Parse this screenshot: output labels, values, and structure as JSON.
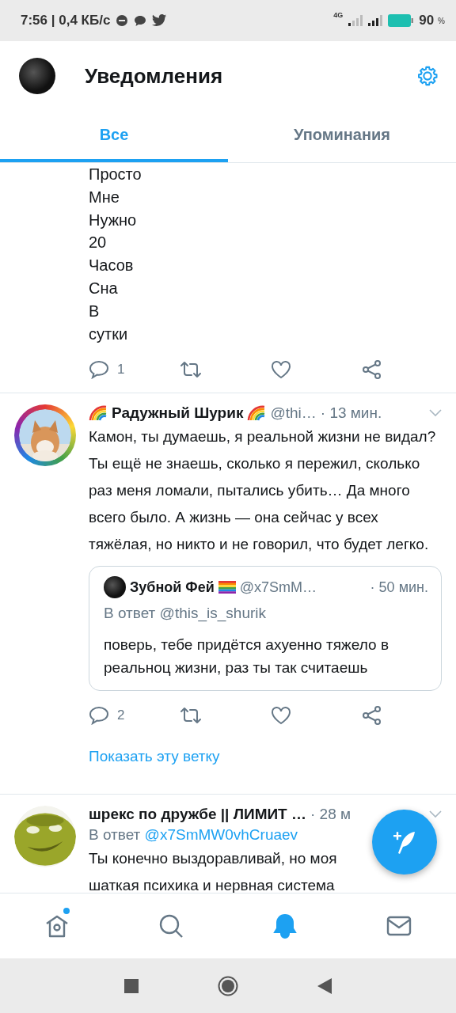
{
  "status_bar": {
    "time_speed": "7:56 | 0,4 КБ/с",
    "network": "4G",
    "battery": "90",
    "percent": "%"
  },
  "header": {
    "title": "Уведомления"
  },
  "tabs": [
    {
      "label": "Все",
      "selected": true
    },
    {
      "label": "Упоминания",
      "selected": false
    }
  ],
  "tweets": [
    {
      "kind": "continuation",
      "words": [
        "Просто",
        "Мне",
        "Нужно",
        "20",
        "Часов",
        "Сна",
        "В",
        "сутки"
      ],
      "replies": "1"
    },
    {
      "kind": "tweet",
      "name": "Радужный Шурик",
      "rainbow": true,
      "handle": "@thi…",
      "time": "· 13 мин.",
      "text": "Камон, ты думаешь, я реальной жизни не видал? Ты ещё не знаешь, сколько я пережил, сколько раз меня ломали, пытались убить… Да много всего было. А жизнь — она сейчас у всех тяжёлая, но никто и не говорил, что будет легко.",
      "quote": {
        "name": "Зубной Фей",
        "handle": "@x7SmM…",
        "time": "· 50 мин.",
        "reply_label": "В ответ",
        "reply_to": "@this_is_shurik",
        "text": "поверь, тебе придётся ахуенно тяжело в реальноц жизни, раз ты так считаешь"
      },
      "replies": "2",
      "show_thread": "Показать эту ветку"
    },
    {
      "kind": "tweet",
      "name": "шрекс по дружбе || ЛИМИТ …",
      "rainbow": false,
      "time": "· 28 м",
      "reply_label": "В ответ",
      "reply_to": "@x7SmMW0vhCruaev",
      "text": "Ты конечно выздоравливай, но моя шаткая психика и нервная система"
    }
  ],
  "bottom_nav": [
    {
      "kind": "home",
      "selected": false,
      "unread": true
    },
    {
      "kind": "search",
      "selected": false,
      "unread": false
    },
    {
      "kind": "bell",
      "selected": true,
      "unread": false
    },
    {
      "kind": "mail",
      "selected": false,
      "unread": false
    }
  ]
}
